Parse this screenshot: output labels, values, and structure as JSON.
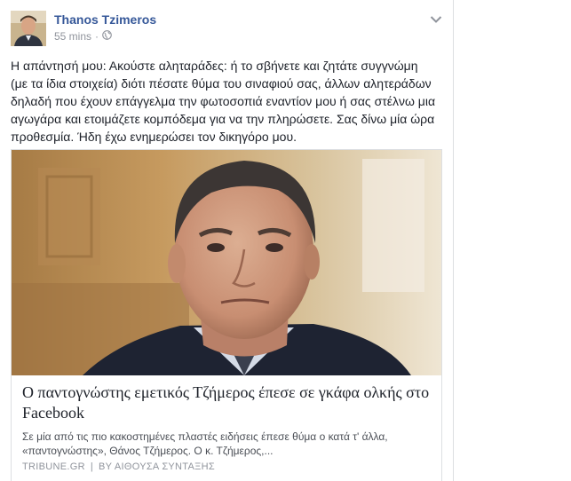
{
  "post": {
    "author": "Thanos Tzimeros",
    "time": "55 mins",
    "separator": "·",
    "text": "Η απάντησή μου: Ακούστε αληταράδες: ή το σβήνετε και ζητάτε συγγνώμη (με τα ίδια στοιχεία) διότι πέσατε θύμα του σιναφιού σας, άλλων αλητεράδων δηλαδή που έχουν επάγγελμα την φωτοσοπιά εναντίον μου ή σας στέλνω μια αγωγάρα και ετοιμάζετε κομπόδεμα για να την πληρώσετε. Σας δίνω μία ώρα προθεσμία. Ήδη έχω ενημερώσει τον δικηγόρο μου."
  },
  "link": {
    "title": "Ο παντογνώστης εμετικός Τζήμερος έπεσε σε γκάφα ολκής στο Facebook",
    "description": "Σε μία από τις πιο κακοστημένες πλαστές ειδήσεις έπεσε θύμα ο κατά τ' άλλα, «παντογνώστης», Θάνος Τζήμερος. Ο κ. Τζήμερος,...",
    "source": "TRIBUNE.GR",
    "source_sep": "|",
    "byline": "ΒΥ ΑΙΘΟΥΣΑ ΣΥΝΤΑΞΗΣ"
  },
  "icons": {
    "privacy": "globe-icon",
    "menu": "chevron-down-icon"
  },
  "colors": {
    "author_link": "#365899",
    "meta": "#90949c",
    "text": "#1d2129",
    "border": "#dddfe2"
  }
}
